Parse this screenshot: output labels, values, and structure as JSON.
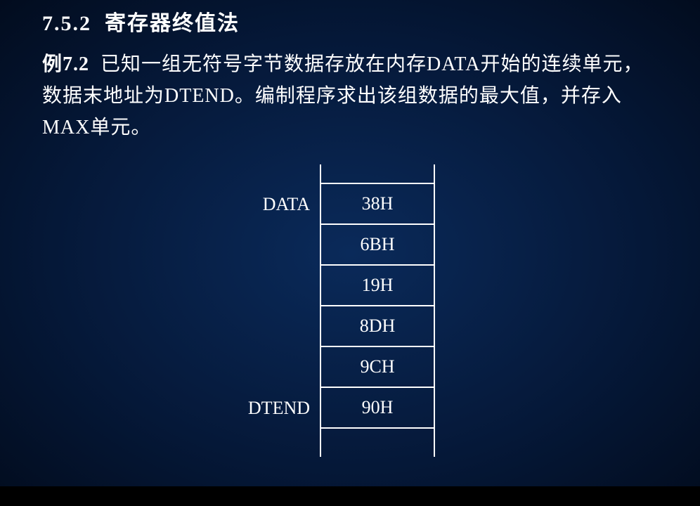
{
  "section": {
    "number": "7.5.2",
    "title": "寄存器终值法"
  },
  "example": {
    "label": "例7.2",
    "text": "已知一组无符号字节数据存放在内存DATA开始的连续单元，数据末地址为DTEND。编制程序求出该组数据的最大值，并存入MAX单元。"
  },
  "memory": {
    "start_label": "DATA",
    "end_label": "DTEND",
    "cells": [
      "38H",
      "6BH",
      "19H",
      "8DH",
      "9CH",
      "90H"
    ]
  }
}
